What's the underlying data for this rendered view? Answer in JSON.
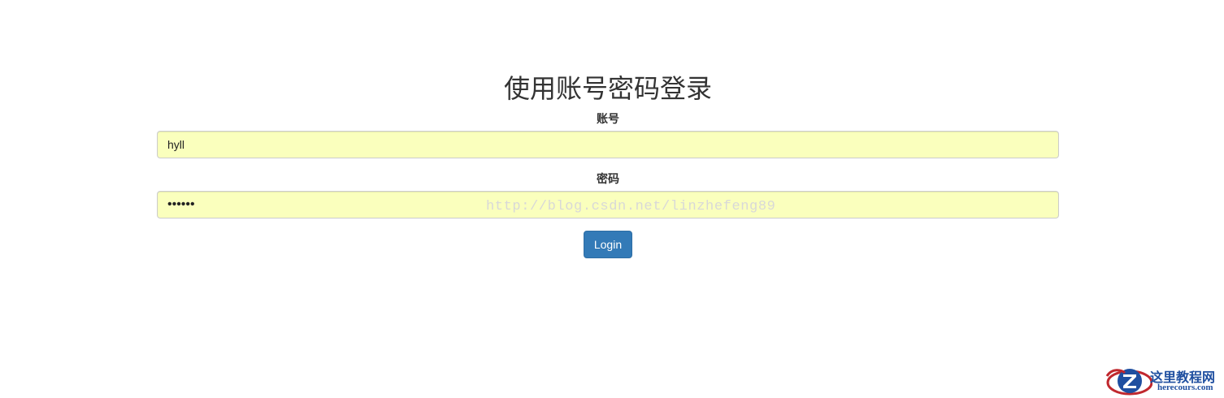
{
  "login": {
    "title": "使用账号密码登录",
    "account_label": "账号",
    "account_value": "hyll",
    "password_label": "密码",
    "password_value": "••••••",
    "submit_label": "Login"
  },
  "watermark": {
    "text": "http://blog.csdn.net/linzhefeng89"
  },
  "site_logo": {
    "name": "这里教程网",
    "url": "herecours.com",
    "icon": "z-letter-logo-icon"
  },
  "colors": {
    "autofill_background": "#faffbd",
    "button_primary": "#337ab7",
    "logo_blue": "#1f4fa0",
    "logo_red": "#c0282e"
  }
}
